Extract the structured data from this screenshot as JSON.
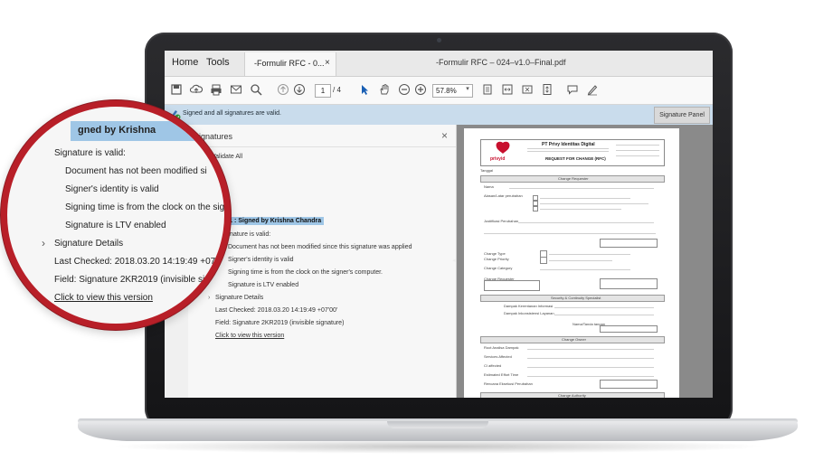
{
  "app": {
    "menu": [
      "Home",
      "Tools"
    ],
    "tab_label": "-Formulir RFC - 0...",
    "tab_close": "×",
    "window_title": "-Formulir RFC – 024–v1.0–Final.pdf"
  },
  "toolbar": {
    "page_current": "1",
    "page_total": "/ 4",
    "zoom": "57.8%"
  },
  "signature_bar": {
    "message": "Signed and all signatures are valid.",
    "button": "Signature Panel"
  },
  "panel": {
    "title": "Signatures",
    "validate_all": "Validate All",
    "revision": "Rev. 1 : Signed by Krishna Chandra",
    "lines": [
      "Signature is valid:",
      "Document has not been modified since this signature was applied",
      "Signer's identity is valid",
      "Signing time is from the clock on the signer's computer.",
      "Signature is LTV enabled",
      "Signature Details",
      "Last Checked: 2018.03.20 14:19:49 +07'00'",
      "Field: Signature 2KR2019 (invisible signature)",
      "Click to view this version"
    ]
  },
  "magnifier": {
    "header": "gned by Krishna",
    "lines": [
      "Signature is valid:",
      "Document has not been modified si",
      "Signer's identity is valid",
      "Signing time is from the clock on the sig",
      "Signature is LTV enabled",
      "Signature Details",
      "Last Checked: 2018.03.20 14:19:49 +07'00",
      "Field: Signature 2KR2019 (invisible signat",
      "Click to view this version"
    ]
  },
  "document": {
    "company": "PT Privy Identitas Digital",
    "form_title": "REQUEST FOR CHANGE (RFC)",
    "logo_text": "privyid",
    "sections": [
      "Change Requester",
      "Security & Continuity Specialist",
      "Change Owner",
      "Change Authority"
    ],
    "labels": [
      "Nama",
      "Tanggal",
      "Alasan/Latar perubahan",
      "Justifikasi Perubahan",
      "Change Type",
      "Change Priority",
      "Change Category",
      "Change Requester",
      "Nama/Tanda tangan",
      "Dampak Kerentanan Informasi",
      "Dampak Inkonsistensi Layanan",
      "Root Analisa Dampak",
      "Services Affected",
      "CI affected",
      "Estimated Effort Time",
      "Rencana Eksekusi Perubahan"
    ]
  },
  "colors": {
    "accent_red": "#b81f28",
    "sigbar_blue": "#c9dcec",
    "highlight_blue": "#9fc6e6"
  }
}
